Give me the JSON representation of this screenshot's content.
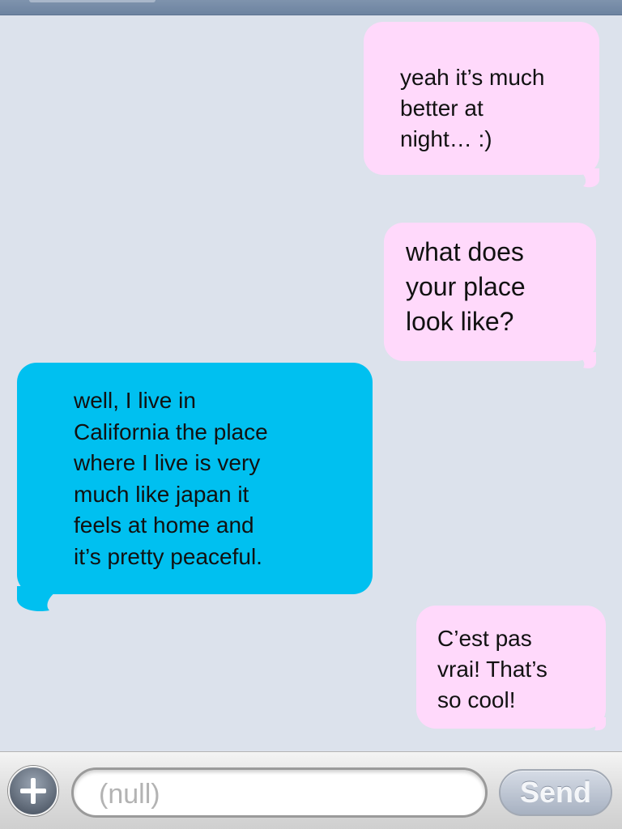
{
  "conversation": {
    "messages": [
      {
        "side": "outgoing",
        "text": "yeah it’s much\nbetter at\nnight… :)"
      },
      {
        "side": "outgoing",
        "text": "what does\nyour place\nlook like?"
      },
      {
        "side": "incoming",
        "text": "well, I live in\nCalifornia the place\nwhere I live is very\nmuch like japan it\nfeels at home and\nit’s pretty peaceful."
      },
      {
        "side": "outgoing",
        "text": "C’est pas\nvrai! That’s\nso cool!"
      }
    ]
  },
  "compose_bar": {
    "input_placeholder": "(null)",
    "send_label": "Send",
    "add_icon": "plus-icon"
  },
  "colors": {
    "background": "#dce2ec",
    "outgoing_bubble": "#ffd9fb",
    "incoming_bubble": "#00c0f0"
  }
}
